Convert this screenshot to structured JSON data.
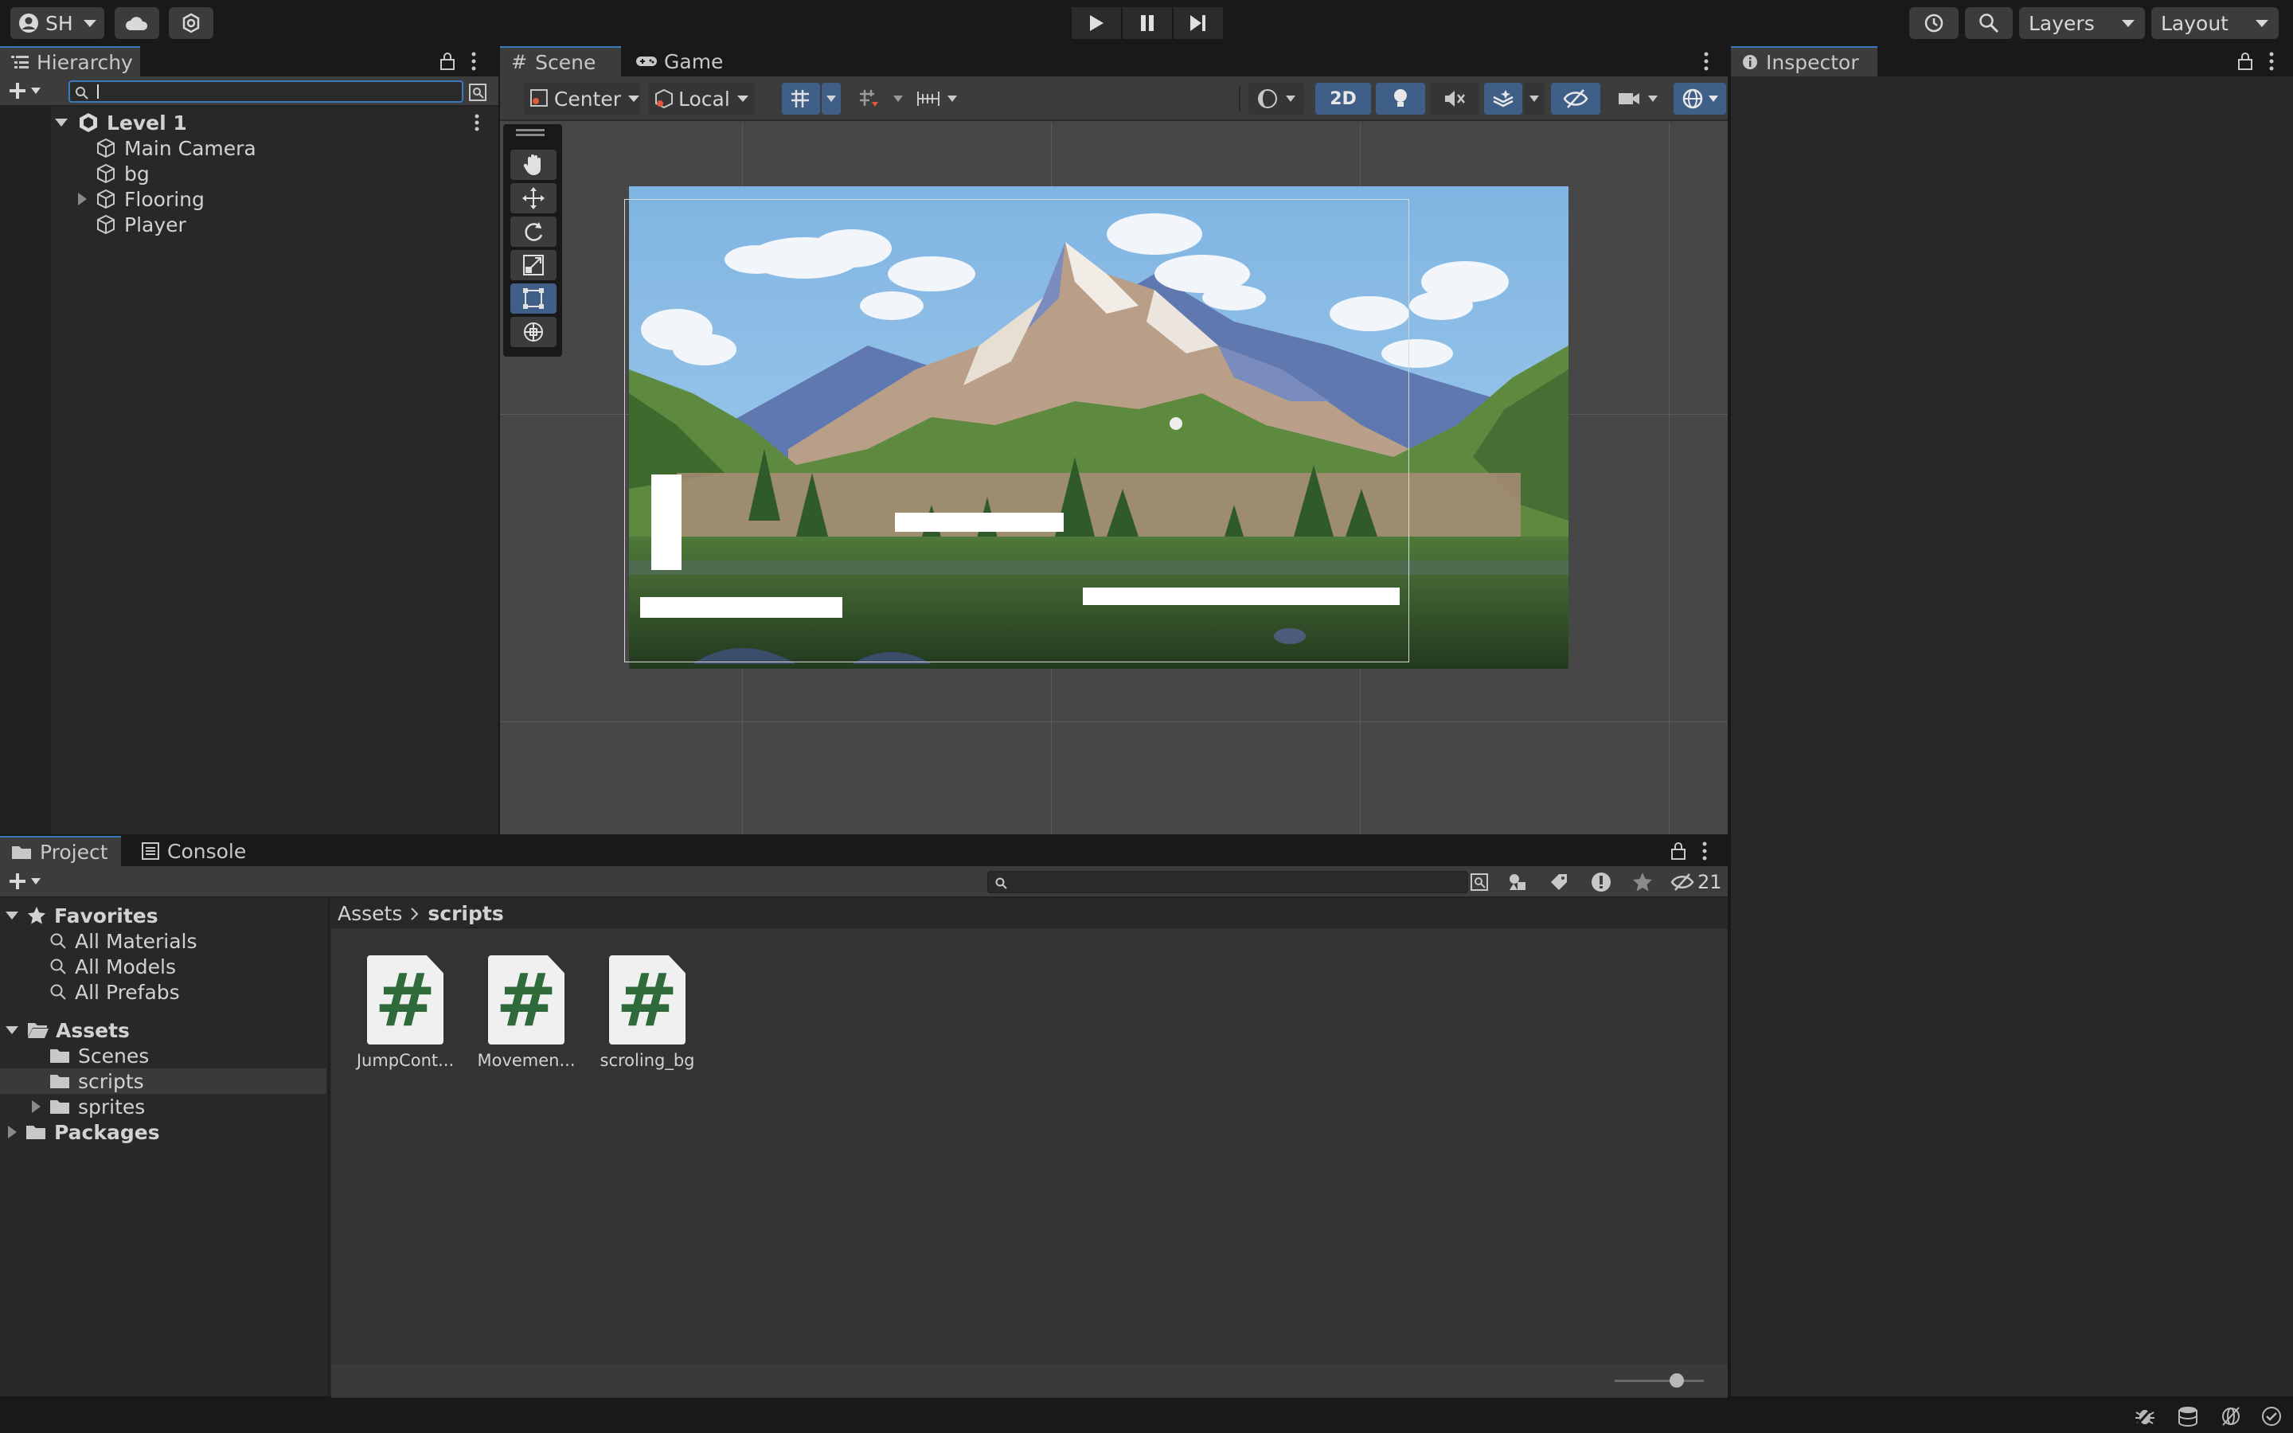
{
  "toolbar": {
    "account_label": "SH",
    "layers_label": "Layers",
    "layout_label": "Layout"
  },
  "hierarchy": {
    "tab_label": "Hierarchy",
    "search_value": "",
    "scene_name": "Level 1",
    "items": [
      {
        "label": "Main Camera"
      },
      {
        "label": "bg"
      },
      {
        "label": "Flooring"
      },
      {
        "label": "Player"
      }
    ]
  },
  "scene_view": {
    "tabs": [
      {
        "label": "Scene"
      },
      {
        "label": "Game"
      }
    ],
    "pivot_label": "Center",
    "space_label": "Local",
    "mode_2d_label": "2D"
  },
  "inspector": {
    "tab_label": "Inspector"
  },
  "project": {
    "tabs": [
      {
        "label": "Project"
      },
      {
        "label": "Console"
      }
    ],
    "search_value": "",
    "hidden_count": "21",
    "favorites_label": "Favorites",
    "favorites": [
      {
        "label": "All Materials"
      },
      {
        "label": "All Models"
      },
      {
        "label": "All Prefabs"
      }
    ],
    "assets_label": "Assets",
    "asset_folders": [
      {
        "label": "Scenes"
      },
      {
        "label": "scripts"
      },
      {
        "label": "sprites"
      }
    ],
    "packages_label": "Packages",
    "breadcrumb": [
      "Assets",
      "scripts"
    ],
    "files": [
      {
        "name": "JumpCont...",
        "icon": "csharp-script-icon"
      },
      {
        "name": "Movemen...",
        "icon": "csharp-script-icon"
      },
      {
        "name": "scroling_bg",
        "icon": "csharp-script-icon"
      }
    ],
    "icon_size_slider": 0.7
  },
  "colors": {
    "accent_blue": "#3f5f88",
    "tab_highlight": "#3a79bb",
    "script_hash": "#2f6b3a",
    "sky": "#8ec0e6"
  }
}
